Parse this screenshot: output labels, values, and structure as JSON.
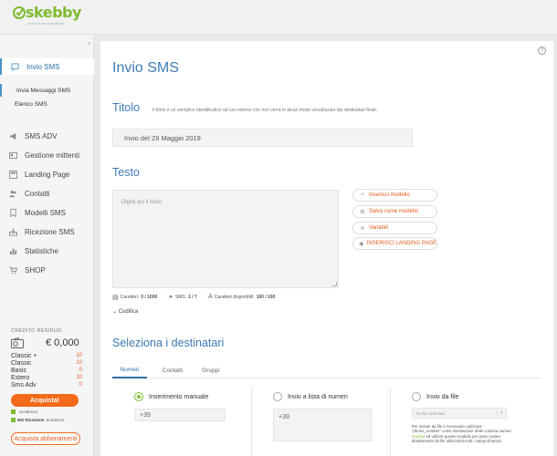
{
  "brand": {
    "name": "skebby",
    "tagline": "cloud sms solutions",
    "color": "#7dbb2f"
  },
  "accent": {
    "blue": "#3f7ab5",
    "orange": "#f36b1a"
  },
  "sidebar": {
    "collapse_glyph": "‹",
    "items": [
      {
        "label": "Invio SMS",
        "icon": "chat-bubble-icon",
        "glyph": "💬"
      },
      {
        "label": "SMS ADV",
        "icon": "megaphone-icon",
        "glyph": "📢"
      },
      {
        "label": "Gestione mittenti",
        "icon": "id-card-icon",
        "glyph": "▤"
      },
      {
        "label": "Landing Page",
        "icon": "page-icon",
        "glyph": "▦"
      },
      {
        "label": "Contatti",
        "icon": "people-icon",
        "glyph": "👥"
      },
      {
        "label": "Modelli SMS",
        "icon": "bookmark-icon",
        "glyph": "🔖"
      },
      {
        "label": "Ricezione SMS",
        "icon": "inbox-icon",
        "glyph": "📥"
      },
      {
        "label": "Statistiche",
        "icon": "chart-icon",
        "glyph": "📊"
      },
      {
        "label": "SHOP",
        "icon": "cart-icon",
        "glyph": "🛒"
      }
    ],
    "subitems": [
      {
        "label": "Invia Messaggi SMS"
      },
      {
        "label": "Elenco SMS"
      }
    ]
  },
  "credit": {
    "title": "CREDITO RESIDUO",
    "balance": "€ 0,000",
    "rows": [
      {
        "label": "Classic +",
        "value": "10"
      },
      {
        "label": "Classic",
        "value": "10"
      },
      {
        "label": "Basic",
        "value": "0"
      },
      {
        "label": "Estero",
        "value": "10"
      },
      {
        "label": "Sms Adv",
        "value": "0"
      }
    ],
    "buy_label": "Acquista!",
    "options": [
      {
        "bold": "",
        "label": "Scadenza"
      },
      {
        "bold": "MO Ricezione",
        "label": "Scadenza"
      }
    ],
    "subscription_label": "Acquista abbonamenti"
  },
  "main": {
    "help_glyph": "?",
    "page_title": "Invio SMS",
    "titolo": {
      "heading": "Titolo",
      "hint": "Il titolo è un semplice identificativo ad uso interno che non verrà in alcun modo visualizzato dai destinatari finali.",
      "value": "Invio del 29 Maggio 2019"
    },
    "testo": {
      "heading": "Testo",
      "placeholder": "Digita qui il testo",
      "actions": [
        {
          "label": "Inserisci modello",
          "glyph": "+",
          "icon": "plus-icon"
        },
        {
          "label": "Salva come modello",
          "glyph": "⚙",
          "icon": "save-icon"
        },
        {
          "label": "Variabili",
          "glyph": "✕",
          "icon": "variables-icon"
        },
        {
          "label": "INSERISCI LANDING PAGE",
          "glyph": "◉",
          "icon": "landing-page-icon"
        }
      ],
      "counters": [
        {
          "label": "Caratteri:",
          "value": "0 / 1000",
          "icon": "list-icon",
          "glyph": "▤"
        },
        {
          "label": "SMS:",
          "value": "1 / 7",
          "icon": "link-icon",
          "glyph": "⚭"
        },
        {
          "label": "Caratteri disponibili:",
          "value": "160 / 160",
          "icon": "font-icon",
          "glyph": "A"
        }
      ],
      "codifica_label": "Codifica"
    },
    "destinatari": {
      "heading": "Seleziona i destinatari",
      "tabs": [
        {
          "label": "Numeri"
        },
        {
          "label": "Contatti"
        },
        {
          "label": "Gruppi"
        }
      ],
      "options": [
        {
          "label": "Inserimento manuale",
          "value": "+39"
        },
        {
          "label": "Invio a lista di numeri",
          "value": "+39"
        },
        {
          "label": "Invio da file",
          "placeholder": "No file selected"
        }
      ],
      "file_note": {
        "text": "Per inviare da file è necessario utilizzare \"phone_number\" come intestazione delle colonna numeri.",
        "link": "Scarica",
        "text2": "ed utilizza questo modello per poter inviare direttamente da file utilizzando tutti i campi dinamici"
      }
    }
  }
}
